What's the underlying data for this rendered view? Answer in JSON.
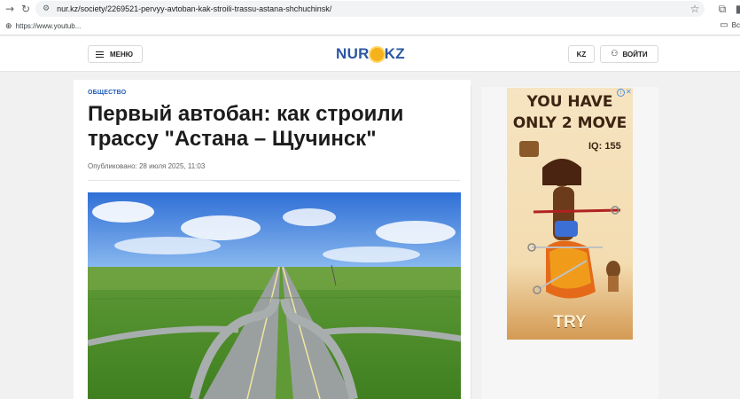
{
  "browser": {
    "url": "nur.kz/society/2269521-pervyy-avtoban-kak-stroili-trassu-astana-shchuchinsk/",
    "bookmark_1": "https://www.youtub...",
    "bookmark_folder": "Вс"
  },
  "header": {
    "menu_label": "МЕНЮ",
    "logo_left": "NUR",
    "logo_right": "KZ",
    "lang_label": "KZ",
    "login_label": "ВОЙТИ"
  },
  "article": {
    "category": "ОБЩЕСТВО",
    "title": "Первый автобан: как строили трассу \"Астана – Щучинск\"",
    "published": "Опубликовано: 28 июля 2025, 11:03"
  },
  "ad": {
    "headline_1": "YOU HAVE",
    "headline_2": "ONLY 2 MOVE",
    "iq": "IQ: 155",
    "cta": "TRY"
  },
  "icons": [
    "back-icon",
    "reload-icon",
    "site-settings-icon",
    "star-icon",
    "extensions-icon",
    "globe-icon",
    "folder-icon",
    "menu-icon",
    "user-icon",
    "ad-info-icon"
  ]
}
